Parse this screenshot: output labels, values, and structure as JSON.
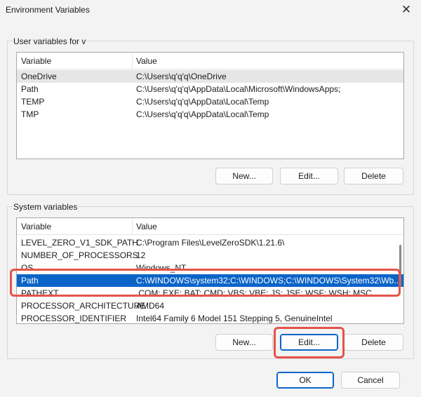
{
  "window": {
    "title": "Environment Variables",
    "close_glyph": "✕"
  },
  "user_group": {
    "label": "User variables for v",
    "columns": [
      "Variable",
      "Value"
    ],
    "rows": [
      {
        "variable": "OneDrive",
        "value": "C:\\Users\\q'q'q\\OneDrive"
      },
      {
        "variable": "Path",
        "value": "C:\\Users\\q'q'q\\AppData\\Local\\Microsoft\\WindowsApps;"
      },
      {
        "variable": "TEMP",
        "value": "C:\\Users\\q'q'q\\AppData\\Local\\Temp"
      },
      {
        "variable": "TMP",
        "value": "C:\\Users\\q'q'q\\AppData\\Local\\Temp"
      }
    ],
    "buttons": {
      "new": "New...",
      "edit": "Edit...",
      "delete": "Delete"
    }
  },
  "system_group": {
    "label": "System variables",
    "columns": [
      "Variable",
      "Value"
    ],
    "rows": [
      {
        "variable": "LEVEL_ZERO_V1_SDK_PATH",
        "value": "C:\\Program Files\\LevelZeroSDK\\1.21.6\\"
      },
      {
        "variable": "NUMBER_OF_PROCESSORS",
        "value": "12"
      },
      {
        "variable": "OS",
        "value": "Windows_NT"
      },
      {
        "variable": "Path",
        "value": "C:\\WINDOWS\\system32;C:\\WINDOWS;C:\\WINDOWS\\System32\\Wb..."
      },
      {
        "variable": "PATHEXT",
        "value": ".COM;.EXE;.BAT;.CMD;.VBS;.VBE;.JS;.JSE;.WSF;.WSH;.MSC"
      },
      {
        "variable": "PROCESSOR_ARCHITECTURE",
        "value": "AMD64"
      },
      {
        "variable": "PROCESSOR_IDENTIFIER",
        "value": "Intel64 Family 6 Model 151 Stepping 5, GenuineIntel"
      }
    ],
    "buttons": {
      "new": "New...",
      "edit": "Edit...",
      "delete": "Delete"
    }
  },
  "footer": {
    "ok": "OK",
    "cancel": "Cancel"
  },
  "colors": {
    "selection": "#0a64c8",
    "highlight_annotation": "#e5534b"
  }
}
